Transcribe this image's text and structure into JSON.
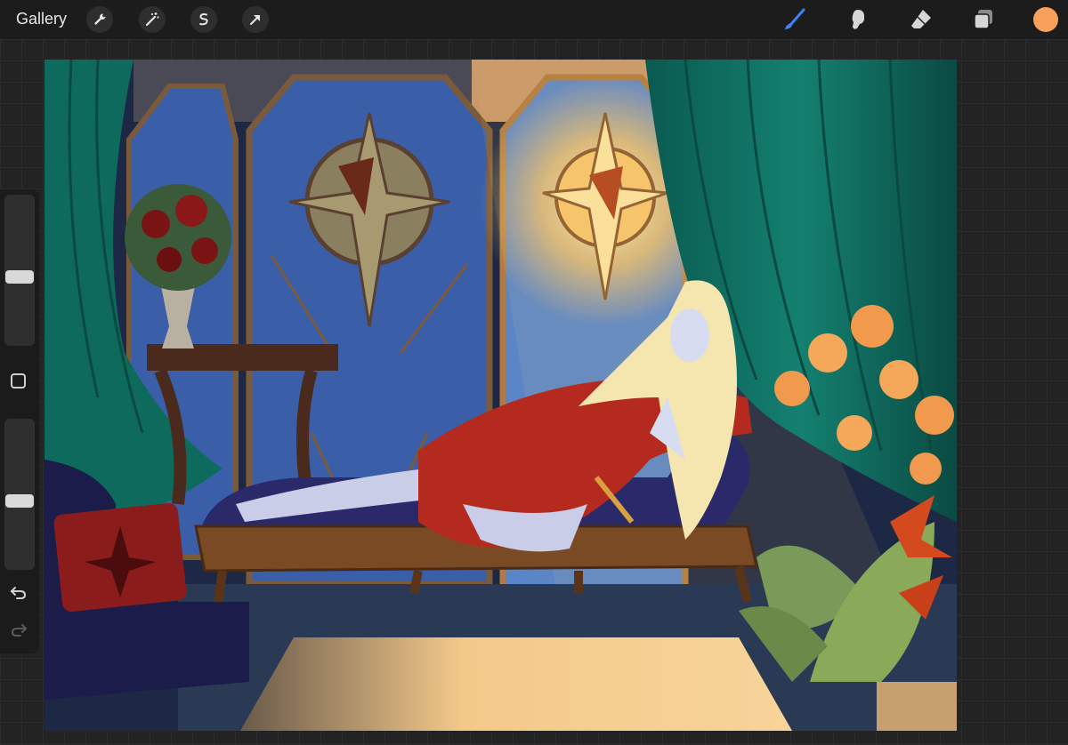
{
  "toolbar": {
    "gallery_label": "Gallery",
    "left_tools": [
      "wrench-icon",
      "magic-wand-icon",
      "selection-icon",
      "transform-arrow-icon"
    ],
    "right_tools": [
      "brush-icon",
      "smudge-icon",
      "eraser-icon",
      "layers-icon"
    ],
    "active_tool": "brush",
    "active_tool_color": "#3b82f6",
    "current_color": "#f7a15a"
  },
  "sidebar": {
    "brush_size_level": 0.45,
    "opacity_level": 0.45,
    "controls": [
      "modify-button-icon",
      "undo-icon",
      "redo-icon"
    ]
  },
  "canvas": {
    "palette": {
      "curtain": "#0f6a5e",
      "window_blue": "#3a5fa8",
      "glow": "#f6c46a",
      "dress": "#b52a1e",
      "hair": "#f5e6b0",
      "chaise": "#2a2a6a",
      "wood": "#7a4a24",
      "flowers": "#f19a4e"
    }
  }
}
